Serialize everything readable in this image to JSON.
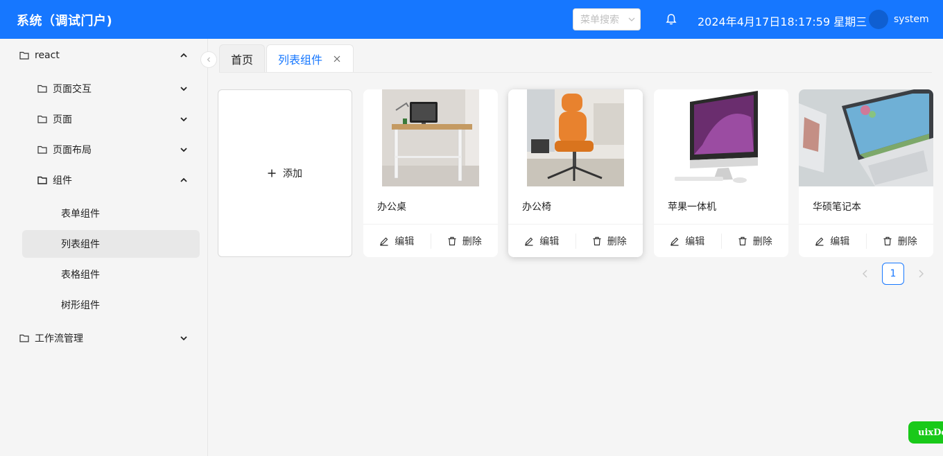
{
  "header": {
    "title": "系统（调试门户)",
    "search_placeholder": "菜单搜索",
    "datetime": "2024年4月17日18:17:59 星期三",
    "username": "system",
    "colors": {
      "primary": "#1677ff"
    }
  },
  "sidebar": {
    "items": [
      {
        "label": "react",
        "icon": "folder-icon",
        "expanded": true
      },
      {
        "label": "页面交互",
        "icon": "folder-icon",
        "expanded": false
      },
      {
        "label": "页面",
        "icon": "folder-icon",
        "expanded": false
      },
      {
        "label": "页面布局",
        "icon": "folder-icon",
        "expanded": false
      },
      {
        "label": "组件",
        "icon": "folder-icon",
        "expanded": true
      },
      {
        "label": "表单组件"
      },
      {
        "label": "列表组件",
        "selected": true
      },
      {
        "label": "表格组件"
      },
      {
        "label": "树形组件"
      },
      {
        "label": "工作流管理",
        "icon": "folder-icon",
        "expanded": false
      }
    ]
  },
  "tabs": {
    "items": [
      {
        "label": "首页"
      },
      {
        "label": "列表组件",
        "active": true
      }
    ]
  },
  "cards": {
    "add_label": "添加",
    "edit_label": "编辑",
    "delete_label": "删除",
    "items": [
      {
        "title": "办公桌",
        "image": "office-desk-image"
      },
      {
        "title": "办公椅",
        "image": "office-chair-image"
      },
      {
        "title": "苹果一体机",
        "image": "imac-image"
      },
      {
        "title": "华硕笔记本",
        "image": "laptop-image"
      }
    ]
  },
  "pagination": {
    "current_page": "1"
  },
  "dev_badge": "uixDev"
}
